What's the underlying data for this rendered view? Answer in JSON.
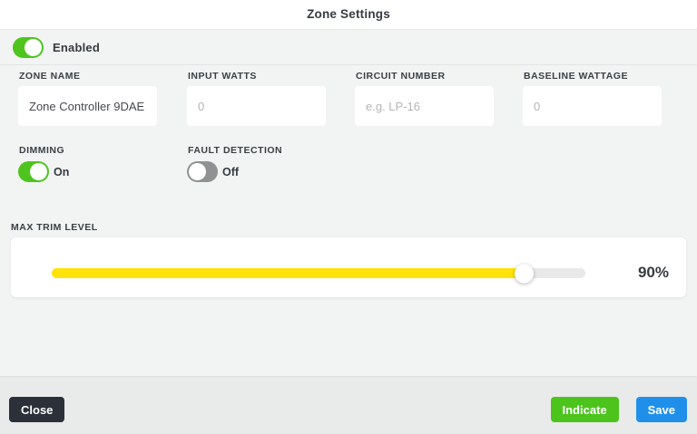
{
  "header": {
    "title": "Zone Settings"
  },
  "enabled": {
    "label": "Enabled",
    "state": "on"
  },
  "fields": [
    {
      "label": "ZONE NAME",
      "value": "Zone Controller 9DAE",
      "placeholder": ""
    },
    {
      "label": "INPUT WATTS",
      "value": "",
      "placeholder": "0"
    },
    {
      "label": "CIRCUIT NUMBER",
      "value": "",
      "placeholder": "e.g. LP-16"
    },
    {
      "label": "BASELINE WATTAGE",
      "value": "",
      "placeholder": "0"
    }
  ],
  "toggles": [
    {
      "label": "DIMMING",
      "state": "on",
      "state_label": "On"
    },
    {
      "label": "FAULT DETECTION",
      "state": "off",
      "state_label": "Off"
    }
  ],
  "slider": {
    "label": "MAX TRIM LEVEL",
    "percent": 90,
    "value_label": "90%",
    "fill_css": "88.6%"
  },
  "footer": {
    "close_label": "Close",
    "indicate_label": "Indicate",
    "save_label": "Save"
  },
  "colors": {
    "toggle_on_green": "#4fc41e",
    "toggle_off_gray": "#909192",
    "slider_yellow": "#ffe30a",
    "indicate_green": "#4cc41c",
    "save_blue": "#1f8fea",
    "close_dark": "#2b3039",
    "background_gray": "#f2f3f3",
    "footer_gray": "#e9eaea"
  }
}
